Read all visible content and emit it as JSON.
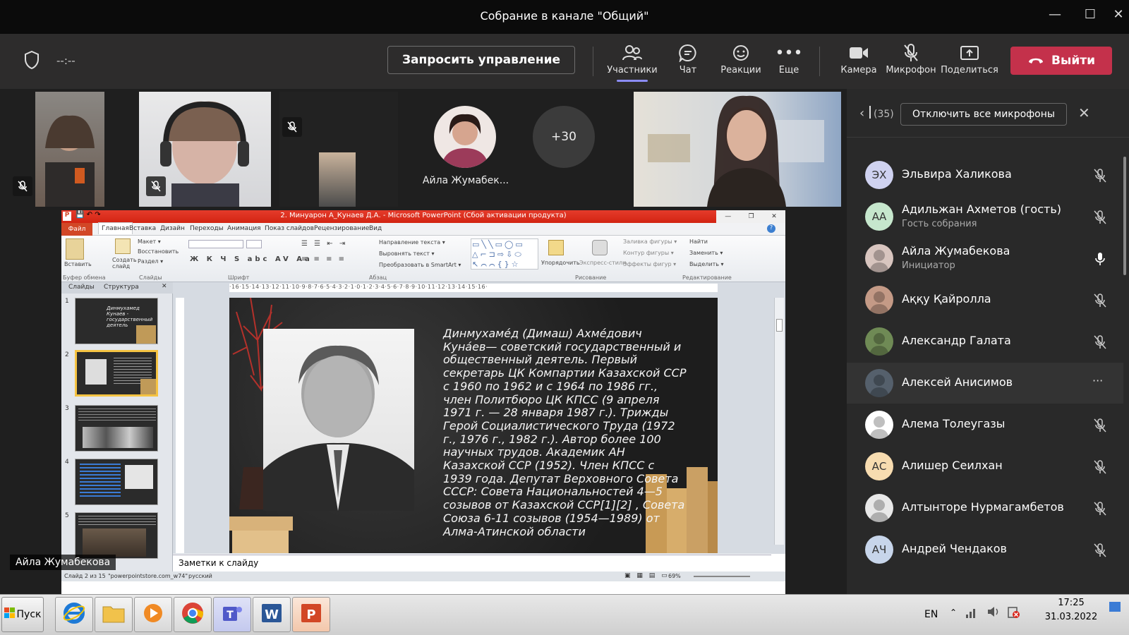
{
  "window": {
    "title": "Собрание в канале \"Общий\"",
    "minimize": "—",
    "maximize": "☐",
    "close": "✕"
  },
  "toolbar": {
    "timer": "--:--",
    "request_control": "Запросить управление",
    "participants": "Участники",
    "chat": "Чат",
    "reactions": "Реакции",
    "more": "Еще",
    "camera": "Камера",
    "microphone": "Микрофон",
    "share": "Поделиться",
    "leave": "Выйти",
    "leave_color": "#c4314b"
  },
  "videos": {
    "featured_name": "Айла Жумабек...",
    "overflow_count": "+30",
    "pinned_label": "Айла Жумабекова"
  },
  "panel": {
    "count": "(35)",
    "mute_all": "Отключить все микрофоны",
    "participants": [
      {
        "initials": "ЭХ",
        "name": "Эльвира Халикова",
        "sub": "",
        "avatar_color": "#cfd2f0",
        "mic": "muted"
      },
      {
        "initials": "АА",
        "name": "Адильжан Ахметов (гость)",
        "sub": "Гость собрания",
        "avatar_color": "#c6e7cd",
        "mic": "muted"
      },
      {
        "initials": "",
        "name": "Айла Жумабекова",
        "sub": "Инициатор",
        "avatar_color": "#d8c5bf",
        "mic": "on"
      },
      {
        "initials": "",
        "name": "Аққу Қайролла",
        "sub": "",
        "avatar_color": "#c49a86",
        "mic": "muted"
      },
      {
        "initials": "",
        "name": "Александр Галата",
        "sub": "",
        "avatar_color": "#6f8a55",
        "mic": "muted"
      },
      {
        "initials": "",
        "name": "Алексей Анисимов",
        "sub": "",
        "avatar_color": "#55606c",
        "mic": "more"
      },
      {
        "initials": "",
        "name": "Алема Толеугазы",
        "sub": "",
        "avatar_color": "#ffffff",
        "mic": "muted"
      },
      {
        "initials": "АС",
        "name": "Алишер Сеилхан",
        "sub": "",
        "avatar_color": "#f7dcb0",
        "mic": "muted"
      },
      {
        "initials": "",
        "name": "Алтынторе Нурмагамбетов",
        "sub": "",
        "avatar_color": "#e8e8e8",
        "mic": "muted"
      },
      {
        "initials": "АЧ",
        "name": "Андрей Чендаков",
        "sub": "",
        "avatar_color": "#c7d5ea",
        "mic": "muted"
      }
    ],
    "more_glyph": "···"
  },
  "ppt": {
    "title": "2. Минуарон А_Кунаев Д.А. - Microsoft PowerPoint (Сбой активации продукта)",
    "tabs": [
      "Файл",
      "Главная",
      "Вставка",
      "Дизайн",
      "Переходы",
      "Анимация",
      "Показ слайдов",
      "Рецензирование",
      "Вид"
    ],
    "ribbon": {
      "paste": "Вставить",
      "clipboard": "Буфер обмена",
      "new_slide": "Создать слайд",
      "layout": "Макет ▾",
      "reset": "Восстановить",
      "section": "Раздел ▾",
      "slides_group": "Слайды",
      "font_group": "Шрифт",
      "paragraph_group": "Абзац",
      "text_direction": "Направление текста ▾",
      "align_text": "Выровнять текст ▾",
      "smartart": "Преобразовать в SmartArt ▾",
      "arrange": "Упорядочить",
      "quick_styles": "Экспресс-стили",
      "fill": "Заливка фигуры ▾",
      "outline": "Контур фигуры ▾",
      "effects": "Эффекты фигур ▾",
      "drawing_group": "Рисование",
      "find": "Найти",
      "replace": "Заменить ▾",
      "select": "Выделить ▾",
      "editing_group": "Редактирование"
    },
    "left_tabs": [
      "Слайды",
      "Структура"
    ],
    "thumb_numbers": [
      "1",
      "2",
      "3",
      "4",
      "5"
    ],
    "thumb1_text": "Динмухамед Кунаев - государственный деятель",
    "ruler": "·16·15·14·13·12·11·10·9·8·7·6·5·4·3·2·1·0·1·2·3·4·5·6·7·8·9·10·11·12·13·14·15·16·",
    "slide_text": "Динмухаме́д (Димаш) Ахме́дович Куна́ев— советский государственный и общественный деятель. Первый секретарь ЦК Компартии Казахской ССР с 1960 по 1962 и с 1964 по 1986 гг., член Политбюро ЦК КПСС (9 апреля 1971 г. — 28 января 1987 г.). Трижды Герой Социалистического Труда (1972 г., 1976 г., 1982 г.). Автор более 100 научных трудов. Академик АН Казахской ССР (1952). Член КПСС с 1939 года. Депутат Верховного Совета СССР: Совета Национальностей 4—5 созывов от Казахской ССР[1][2] , Совета Союза 6-11 созывов (1954—1989) от Алма-Атинской области",
    "notes": "Заметки к слайду",
    "status_slide": "Слайд 2 из 15",
    "status_theme": "\"powerpointstore.com_w74\"",
    "status_lang": "русский",
    "zoom": "69%"
  },
  "taskbar": {
    "start": "Пуск",
    "lang": "EN",
    "time": "17:25",
    "date": "31.03.2022"
  }
}
